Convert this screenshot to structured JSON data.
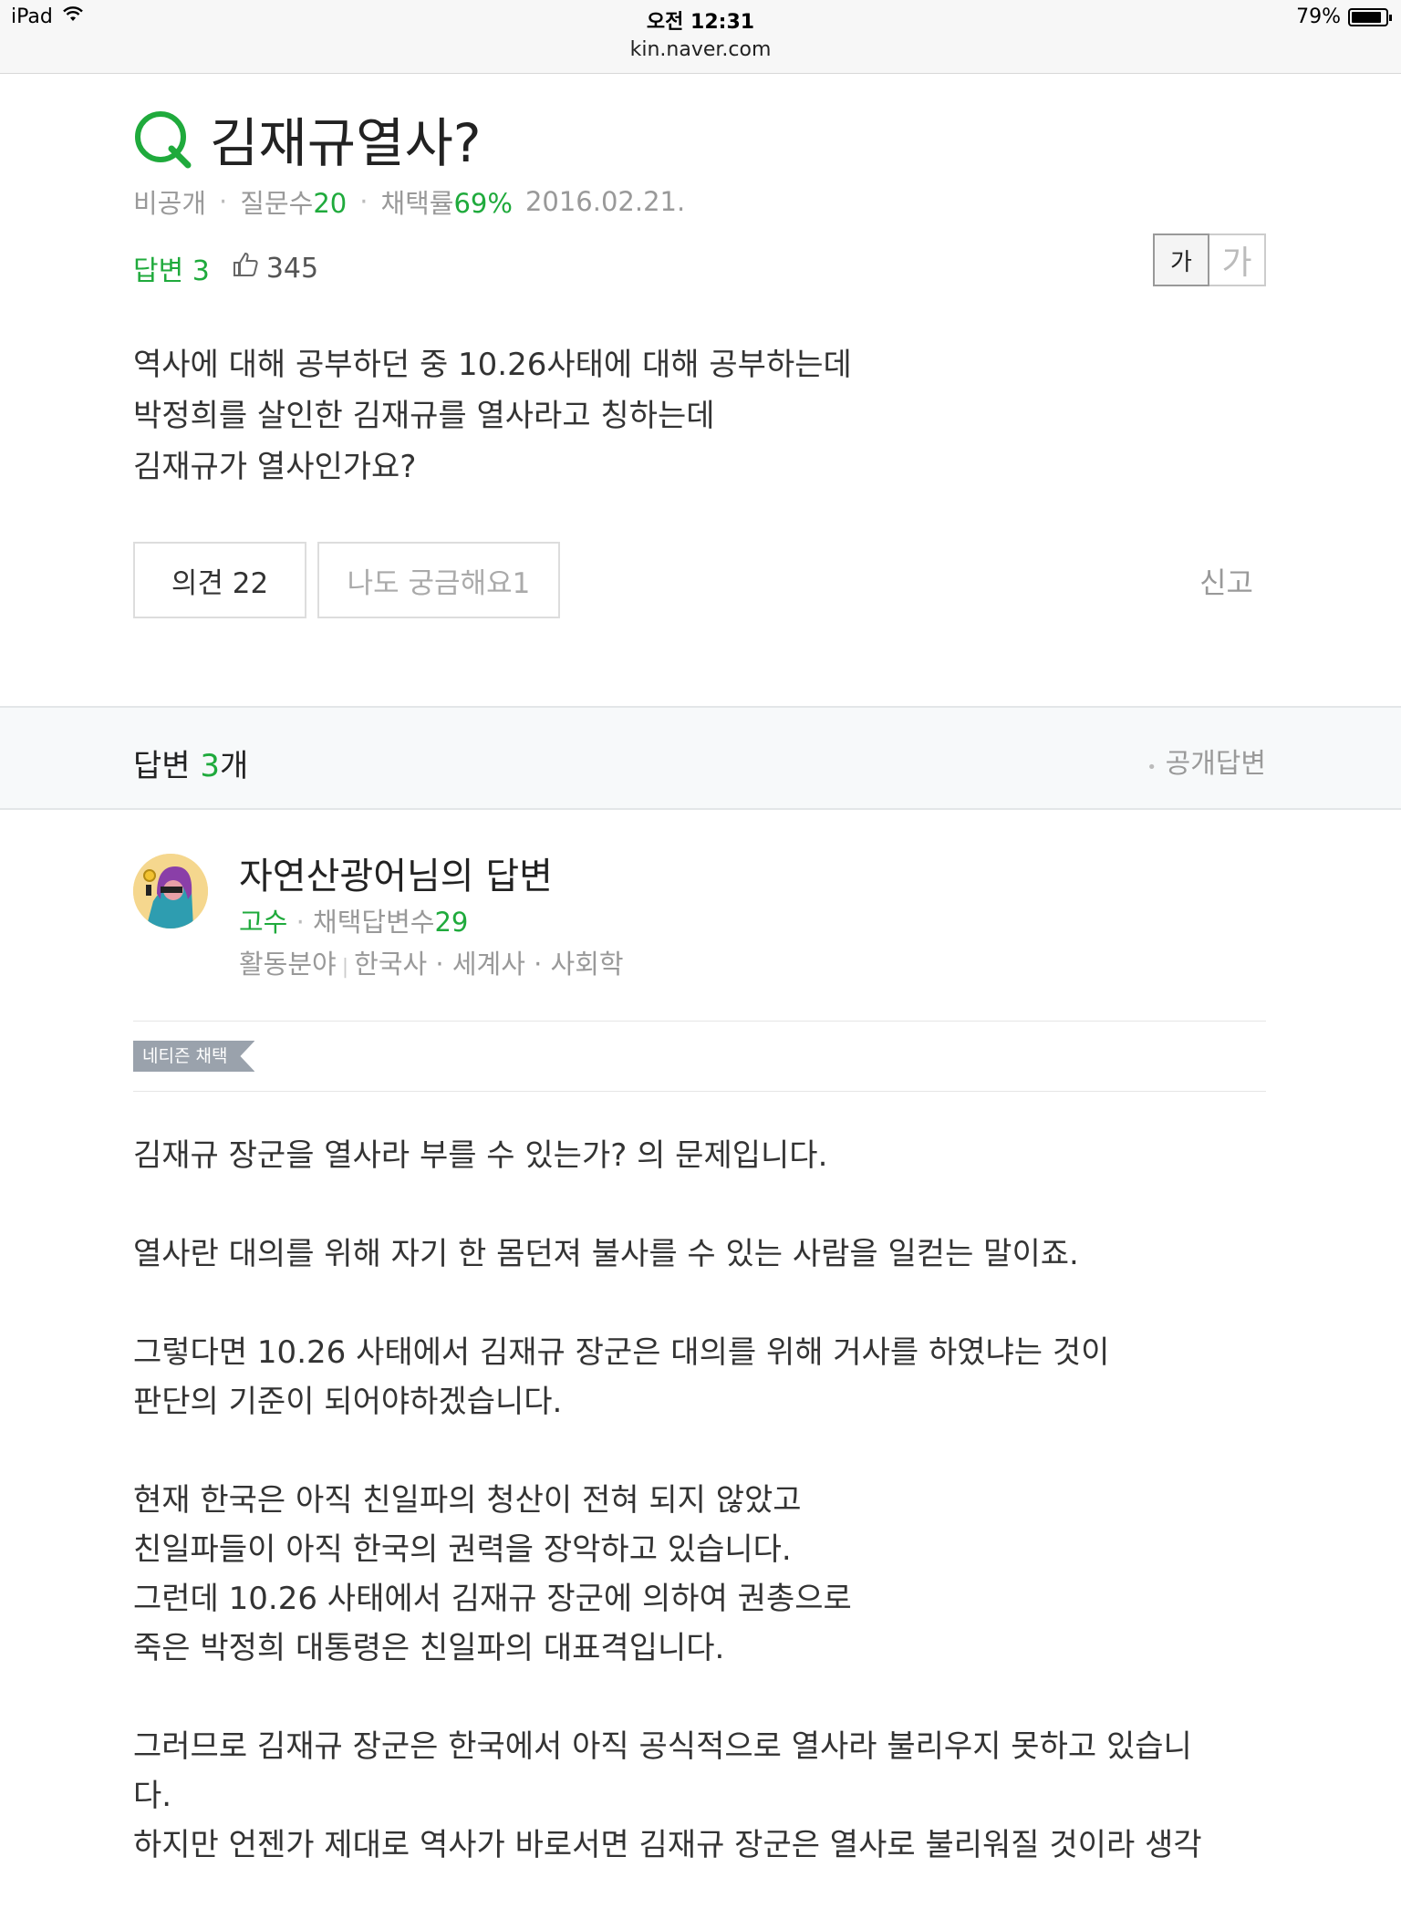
{
  "status_bar": {
    "device": "iPad",
    "time": "오전 12:31",
    "url": "kin.naver.com",
    "battery": "79%",
    "battery_level": 0.79
  },
  "question": {
    "title": "김재규열사?",
    "author": "비공개",
    "question_count_label": "질문수",
    "question_count": "20",
    "adopt_rate_label": "채택률",
    "adopt_rate": "69%",
    "date": "2016.02.21.",
    "answers_label": "답변 3",
    "likes": "345",
    "font_small": "가",
    "font_large": "가",
    "body": [
      "역사에 대해 공부하던 중 10.26사태에 대해 공부하는데",
      "박정희를 살인한 김재규를 열사라고 칭하는데",
      "김재규가 열사인가요?"
    ],
    "opinion_button": "의견 22",
    "curious_button": "나도 궁금해요1",
    "report": "신고"
  },
  "answers_header": {
    "label": "답변",
    "count": "3",
    "suffix": "개",
    "public": "공개답변"
  },
  "answer": {
    "name": "자연산광어님의 답변",
    "rank": "고수",
    "adopted_label": "채택답변수",
    "adopted_count": "29",
    "field_label": "활동분야",
    "fields": "한국사 · 세계사 · 사회학",
    "badge": "네티즌 채택",
    "paragraphs": [
      [
        "김재규 장군을 열사라 부를 수 있는가? 의 문제입니다."
      ],
      [
        "열사란 대의를 위해 자기 한 몸던져 불사를 수 있는 사람을 일컫는 말이죠."
      ],
      [
        "그렇다면 10.26 사태에서 김재규 장군은 대의를 위해 거사를 하였냐는 것이",
        "판단의 기준이 되어야하겠습니다."
      ],
      [
        "현재 한국은 아직 친일파의 청산이 전혀 되지 않았고",
        "친일파들이 아직 한국의 권력을 장악하고 있습니다.",
        "그런데 10.26 사태에서 김재규 장군에 의하여 권총으로",
        "죽은 박정희 대통령은 친일파의 대표격입니다."
      ],
      [
        "그러므로 김재규 장군은 한국에서 아직 공식적으로 열사라 불리우지 못하고 있습니",
        "다.",
        "하지만 언젠가 제대로 역사가 바로서면 김재규 장군은 열사로 불리워질 것이라 생각"
      ]
    ]
  }
}
